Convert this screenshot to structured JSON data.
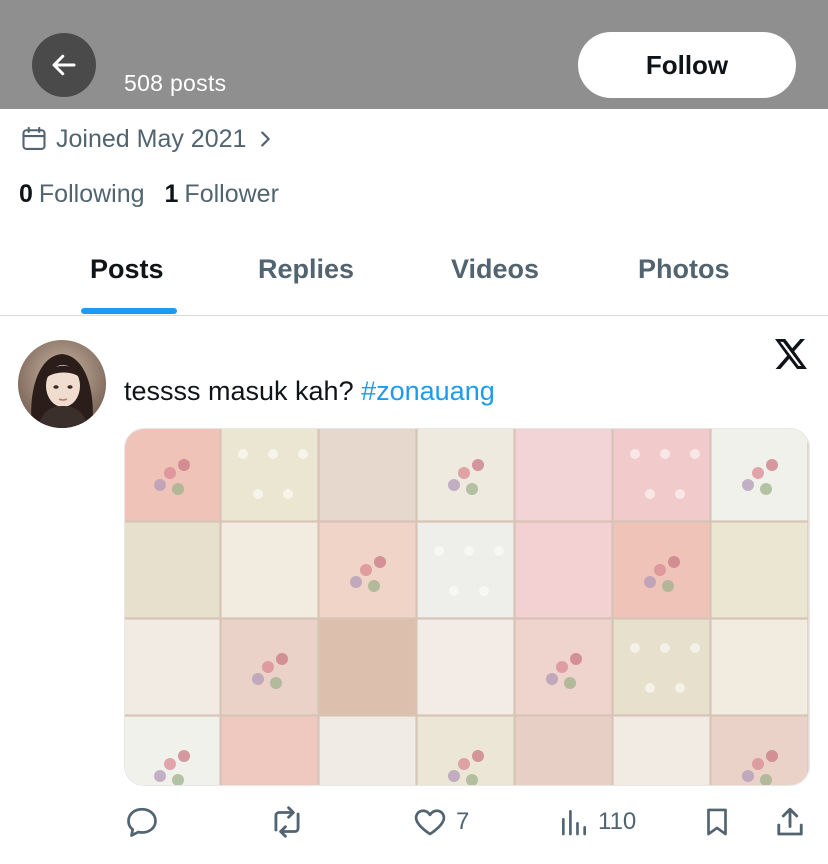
{
  "header": {
    "posts_count": "508 posts",
    "follow_label": "Follow"
  },
  "profile": {
    "joined": "Joined May 2021",
    "following_count": "0",
    "following_label": "Following",
    "followers_count": "1",
    "followers_label": "Follower"
  },
  "tabs": [
    {
      "label": "Posts",
      "active": true
    },
    {
      "label": "Replies",
      "active": false
    },
    {
      "label": "Videos",
      "active": false
    },
    {
      "label": "Photos",
      "active": false
    }
  ],
  "post": {
    "text": "tessss masuk kah? ",
    "hashtag": "#zonauang",
    "likes": "7",
    "views": "110"
  },
  "icons": {
    "back": "arrow-left-icon",
    "calendar": "calendar-icon",
    "chevron": "chevron-right-icon",
    "x_logo": "x-logo-icon",
    "reply": "reply-icon",
    "repost": "repost-icon",
    "like": "heart-icon",
    "views": "views-icon",
    "bookmark": "bookmark-icon",
    "share": "share-icon"
  },
  "colors": {
    "accent": "#1d9bf0",
    "header_bg": "#8f8f8f",
    "muted_text": "#536471",
    "text": "#0f1419"
  }
}
